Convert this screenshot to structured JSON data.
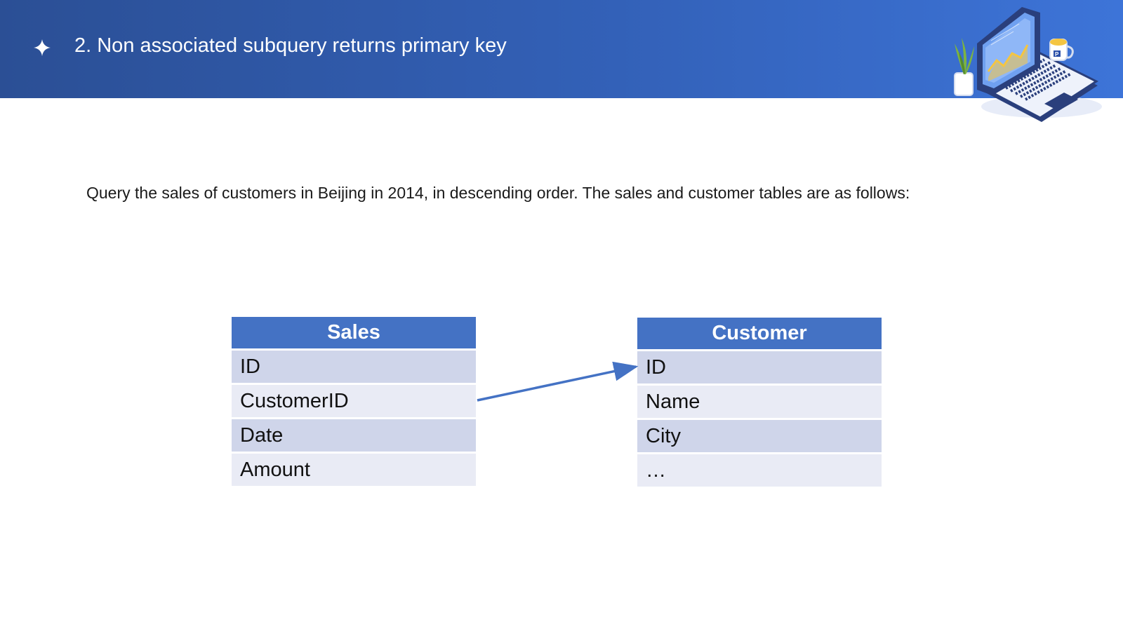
{
  "header": {
    "title": "2. Non associated subquery returns primary key",
    "bullet_icon": "four-point-star-icon",
    "illustration": "laptop-with-chart-illustration",
    "colors": {
      "gradient_start": "#2b4f95",
      "gradient_end": "#3d74d8"
    }
  },
  "content": {
    "description": "Query the sales of customers in Beijing in 2014, in descending order. The sales and customer tables are as follows:"
  },
  "diagram": {
    "tables": {
      "sales": {
        "title": "Sales",
        "rows": [
          "ID",
          "CustomerID",
          "Date",
          "Amount"
        ]
      },
      "customer": {
        "title": "Customer",
        "rows": [
          "ID",
          "Name",
          "City",
          "…"
        ]
      }
    },
    "relation": {
      "from": "Sales.CustomerID",
      "to": "Customer.ID"
    },
    "colors": {
      "header": "#4472c4",
      "row_odd": "#cfd5ea",
      "row_even": "#e9ebf5",
      "arrow": "#4472c4"
    }
  }
}
